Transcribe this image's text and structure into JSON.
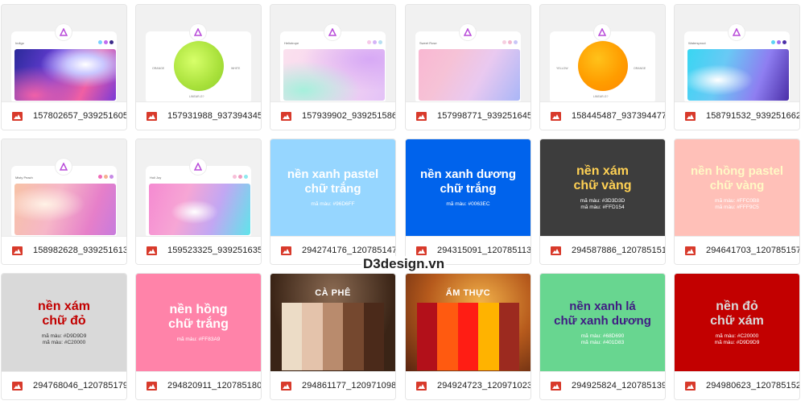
{
  "watermark": "D3design.vn",
  "row1": [
    {
      "file": "157802657_939251605...",
      "name": "Indigo",
      "dots": [
        "#7ad0ff",
        "#c06bf0",
        "#3b2a8a"
      ]
    },
    {
      "file": "157931988_937394345...",
      "left_label": "ORANGE",
      "right_label": "WHITE",
      "bottom_label": "LINEAR-G?"
    },
    {
      "file": "157939902_939251586...",
      "name": "Heliotrope",
      "dots": [
        "#f6c9e8",
        "#d4b3f7",
        "#b7dff2"
      ]
    },
    {
      "file": "157998771_939251645...",
      "name": "Sweet Rose",
      "dots": [
        "#f6cfe0",
        "#f2b7cf",
        "#c9c5f7"
      ]
    },
    {
      "file": "158445487_937394477...",
      "left_label": "YELLOW",
      "right_label": "ORANGE",
      "bottom_label": "LINEAR-G?"
    },
    {
      "file": "158791532_939251662...",
      "name": "Watersprout",
      "dots": [
        "#5dd3f5",
        "#9f6df0",
        "#4b2fa8"
      ]
    }
  ],
  "row2": [
    {
      "file": "158982628_939251613...",
      "name": "Misty Peach",
      "dots": [
        "#f06ab8",
        "#f5b08f",
        "#c68ae6"
      ]
    },
    {
      "file": "159523325_939251635...",
      "name": "Holi Joy",
      "dots": [
        "#f7c0d8",
        "#f09ac0",
        "#8fe8ee"
      ]
    },
    {
      "file": "294274176_120785147...",
      "line1": "nền xanh pastel",
      "line2": "chữ trắng",
      "codes": [
        "mã màu: #96D6FF"
      ]
    },
    {
      "file": "294315091_120785113...",
      "line1": "nền xanh dương",
      "line2": "chữ trắng",
      "codes": [
        "mã màu: #0063EC"
      ]
    },
    {
      "file": "294587886_120785151...",
      "line1": "nền xám",
      "line2": "chữ vàng",
      "codes": [
        "mã màu: #3D3D3D",
        "mã màu: #FFD154"
      ]
    },
    {
      "file": "294641703_120785157...",
      "line1": "nền hồng pastel",
      "line2": "chữ vàng",
      "codes": [
        "mã màu: #FFC0B8",
        "mã màu: #FFF9C5"
      ]
    }
  ],
  "row3": [
    {
      "file": "294768046_120785179...",
      "line1": "nền xám",
      "line2": "chữ đỏ",
      "codes": [
        "mã màu: #D9D9D9",
        "mã màu: #C20000"
      ]
    },
    {
      "file": "294820911_120785180...",
      "line1": "nền hồng",
      "line2": "chữ trắng",
      "codes": [
        "mã màu: #FF83A9"
      ]
    },
    {
      "file": "294861177_120971098...",
      "title": "CÀ PHÊ",
      "swatches": [
        "#ecdcc6",
        "#e4c3ab",
        "#b98b6d",
        "#75482f",
        "#4b2a1a"
      ]
    },
    {
      "file": "294924723_120971023...",
      "title": "ẨM THỰC",
      "swatches": [
        "#b3101a",
        "#ff5a10",
        "#ff1d14",
        "#ffb300",
        "#9c2a1f"
      ]
    },
    {
      "file": "294925824_120785139...",
      "line1": "nền xanh lá",
      "line2": "chữ xanh dương",
      "codes": [
        "mã màu: #68D690",
        "mã màu: #401D83"
      ]
    },
    {
      "file": "294980623_120785152...",
      "line1": "nền đỏ",
      "line2": "chữ xám",
      "codes": [
        "mã màu: #C20000",
        "mã màu: #D9D9D9"
      ]
    }
  ]
}
